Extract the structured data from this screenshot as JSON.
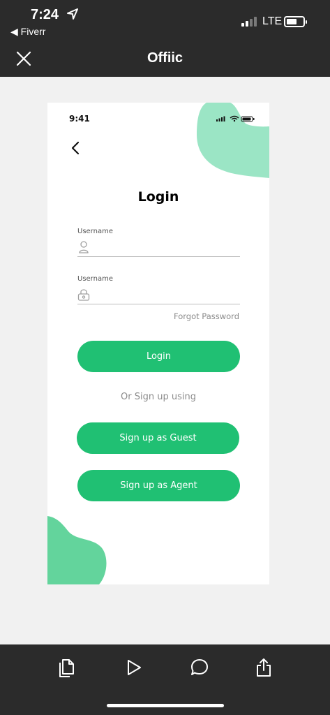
{
  "os_status": {
    "time": "7:24",
    "back_app": "◀ Fiverr",
    "network": "LTE"
  },
  "header": {
    "title": "Offiic"
  },
  "phone": {
    "status_time": "9:41",
    "title": "Login",
    "username_label": "Username",
    "password_label": "Username",
    "username_value": "",
    "password_value": "",
    "forgot_password": "Forgot Password",
    "login_button": "Login",
    "or_text": "Or Sign up using",
    "guest_button": "Sign up as Guest",
    "agent_button": "Sign up as Agent"
  },
  "colors": {
    "accent": "#20c073",
    "blob_top": "#9be5c5",
    "blob_bottom": "#63d49c",
    "chrome": "#2b2b2b"
  },
  "toolbar": {
    "icons": [
      "copy-icon",
      "play-icon",
      "comment-icon",
      "share-icon"
    ]
  }
}
